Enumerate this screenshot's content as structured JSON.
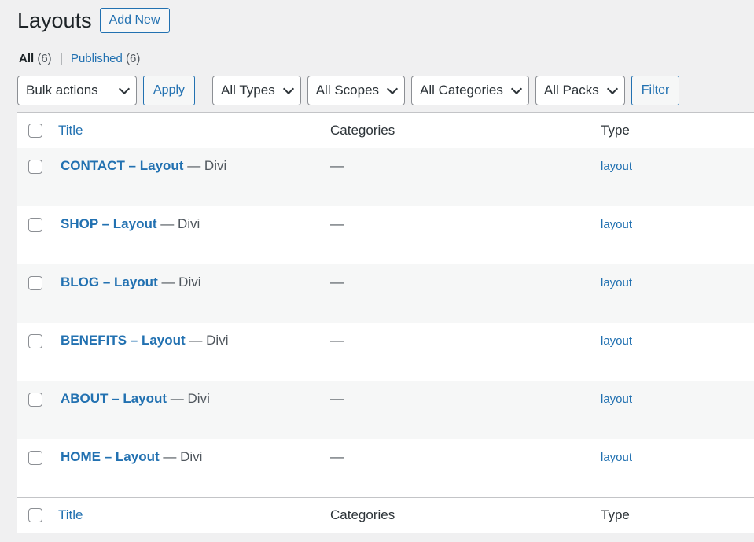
{
  "header": {
    "title": "Layouts",
    "add_new_label": "Add New"
  },
  "views": {
    "all_label": "All",
    "all_count": "(6)",
    "separator": "|",
    "published_label": "Published",
    "published_count": "(6)"
  },
  "filters": {
    "bulk_actions": "Bulk actions",
    "apply_label": "Apply",
    "types": "All Types",
    "scopes": "All Scopes",
    "categories": "All Categories",
    "packs": "All Packs",
    "filter_label": "Filter"
  },
  "table": {
    "columns": {
      "title": "Title",
      "categories": "Categories",
      "type": "Type"
    },
    "rows": [
      {
        "name": "CONTACT – Layout",
        "state": " — Divi",
        "category": "—",
        "type": "layout"
      },
      {
        "name": "SHOP – Layout",
        "state": " — Divi",
        "category": "—",
        "type": "layout"
      },
      {
        "name": "BLOG – Layout",
        "state": " — Divi",
        "category": "—",
        "type": "layout"
      },
      {
        "name": "BENEFITS – Layout",
        "state": " — Divi",
        "category": "—",
        "type": "layout"
      },
      {
        "name": "ABOUT – Layout",
        "state": " — Divi",
        "category": "—",
        "type": "layout"
      },
      {
        "name": "HOME – Layout",
        "state": " — Divi",
        "category": "—",
        "type": "layout"
      }
    ]
  },
  "colors": {
    "accent": "#2271b1",
    "background": "#f0f0f1",
    "row_alt": "#f6f7f7"
  }
}
